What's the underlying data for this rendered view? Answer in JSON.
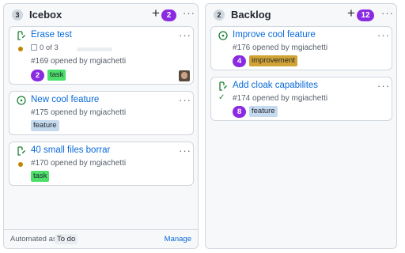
{
  "columns": [
    {
      "count": "3",
      "title": "Icebox",
      "add_symbol": "+",
      "pill": "2",
      "menu": "···",
      "cards": [
        {
          "icon": "issue-draft-icon",
          "title": "Erase test",
          "menu": "···",
          "progress_text": "0 of 3",
          "progress_fraction": 0,
          "meta": "#169 opened by mgiachetti",
          "num_pill": "2",
          "label": "task",
          "label_color": "#4ce06a",
          "has_avatar": true
        },
        {
          "icon": "issue-open-icon",
          "title": "New cool feature",
          "menu": "···",
          "meta": "#175 opened by mgiachetti",
          "label": "feature",
          "label_color": "#c5d9ef"
        },
        {
          "icon": "issue-draft-icon",
          "title": "40 small files borrar",
          "menu": "···",
          "meta": "#170 opened by mgiachetti",
          "label": "task",
          "label_color": "#4ce06a"
        }
      ],
      "footer": {
        "automated_as": "Automated as",
        "todo": "To do",
        "manage": "Manage"
      }
    },
    {
      "count": "2",
      "title": "Backlog",
      "add_symbol": "+",
      "pill": "12",
      "menu": "···",
      "cards": [
        {
          "icon": "issue-open-icon",
          "title": "Improve cool feature",
          "menu": "···",
          "meta": "#176 opened by mgiachetti",
          "num_pill": "4",
          "label": "improvement",
          "label_color": "#d1a334"
        },
        {
          "icon": "issue-draft-icon",
          "title": "Add cloak capabilites",
          "menu": "···",
          "meta": "#174 opened by mgiachetti",
          "num_pill": "8",
          "label": "feature",
          "label_color": "#c5d9ef"
        }
      ]
    }
  ],
  "colors": {
    "accent_purple": "#8a2be2",
    "link_blue": "#0969da",
    "open_green": "#1a7f37",
    "pending_yellow": "#bf8700"
  }
}
